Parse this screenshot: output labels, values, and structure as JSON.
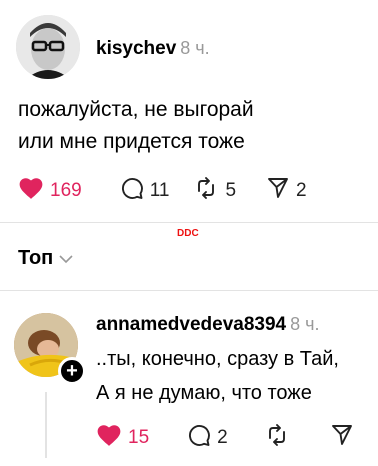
{
  "post": {
    "username": "kisychev",
    "time": "8 ч.",
    "lines": [
      "пожалуйста, не выгорай",
      "или мне придется тоже"
    ],
    "likes": "169",
    "replies": "11",
    "reposts": "5",
    "shares": "2",
    "liked": true
  },
  "watermark": "DDC",
  "sort": {
    "label": "Топ"
  },
  "reply": {
    "username": "annamedvedeva8394",
    "time": "8 ч.",
    "lines": [
      "..ты, конечно, сразу в Тай,",
      "А я не думаю, что тоже"
    ],
    "likes": "15",
    "replies": "2",
    "liked": true
  },
  "colors": {
    "like_red": "#e0245e",
    "divider": "#e3e3e3",
    "muted": "#999999"
  },
  "icons": [
    "heart-icon",
    "comment-icon",
    "repost-icon",
    "share-icon",
    "chevron-down-icon",
    "follow-plus-icon"
  ]
}
